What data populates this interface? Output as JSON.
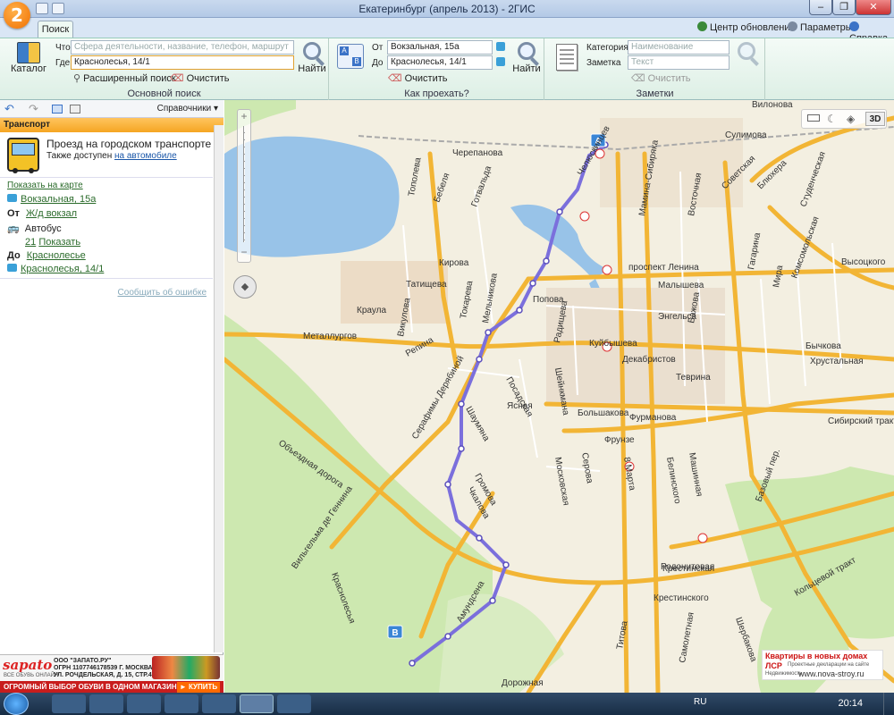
{
  "window": {
    "title": "Екатеринбург (апрель 2013) - 2ГИС"
  },
  "titlebar": {
    "logo_text": "2"
  },
  "top_links": {
    "updates": "Центр обновлений",
    "settings": "Параметры",
    "help": "Справка"
  },
  "tabs": [
    {
      "label": "Поиск"
    }
  ],
  "search": {
    "catalog_label": "Каталог",
    "what_label": "Что",
    "what_placeholder": "Сфера деятельности, название, телефон, маршрут",
    "where_label": "Где",
    "where_value": "Краснолесья, 14/1",
    "find_label": "Найти",
    "advanced_label": "Расширенный поиск",
    "clear_label": "Очистить",
    "group_label": "Основной поиск"
  },
  "route": {
    "from_label": "От",
    "from_value": "Вокзальная, 15а",
    "to_label": "До",
    "to_value": "Краснолесья, 14/1",
    "find_label": "Найти",
    "clear_label": "Очистить",
    "group_label": "Как проехать?"
  },
  "notes": {
    "category_label": "Категория",
    "category_placeholder": "Наименование",
    "note_label": "Заметка",
    "note_placeholder": "Текст",
    "clear_label": "Очистить",
    "group_label": "Заметки"
  },
  "panel": {
    "directories_label": "Справочники",
    "header": "Транспорт",
    "title": "Проезд на городском транспорте",
    "also_prefix": "Также доступен ",
    "also_link": "на автомобиле",
    "show_on_map": "Показать на карте",
    "start_addr": "Вокзальная, 15а",
    "from_label": "От",
    "from_stop": "Ж/д вокзал",
    "mode": "Автобус",
    "route_num": "21",
    "route_show": "Показать",
    "to_label": "До",
    "to_stop": "Краснолесье",
    "end_addr": "Краснолесья, 14/1",
    "report_error": "Сообщить об ошибке"
  },
  "ads": {
    "left_brand": "sapato",
    "left_tag": "ВСЕ ОБУВЬ ОНЛАЙН",
    "left_l1": "ООО \"ЗАПАТО.РУ\"",
    "left_l2": "ОГРН 1107746178539 Г. МОСКВА,",
    "left_l3": "УЛ. РОЧДЕЛЬСКАЯ, Д. 15, СТР.43",
    "left_bottom": "ОГРОМНЫЙ ВЫБОР ОБУВИ В ОДНОМ МАГАЗИНЕ!",
    "left_btn": "► КУПИТЬ",
    "right_title": "Квартиры в новых домах",
    "right_brand": "ЛСР",
    "right_sub": "Недвижимость",
    "right_small": "Проектные декларации на сайте",
    "right_url": "www.nova-stroy.ru"
  },
  "map_controls": {
    "view_3d": "3D"
  },
  "map_markers": {
    "start": "A",
    "end": "B"
  },
  "map_labels": [
    "Черепанова",
    "Бебеля",
    "Готвальда",
    "Тополева",
    "Челюскинцев",
    "Мамина-Сибиряка",
    "Восточная",
    "Советская",
    "Блюхера",
    "Студенческая",
    "Сулимова",
    "Вилонова",
    "Гагарина",
    "Комсомольская",
    "Мира",
    "Высоцкого",
    "проспект Ленина",
    "Малышева",
    "Энгельса",
    "Бажова",
    "Кирова",
    "Татищева",
    "Токарева",
    "Мельникова",
    "Попова",
    "Краула",
    "Викулова",
    "Радищева",
    "Куйбышева",
    "Бычкова",
    "Крестинская",
    "Металлургов",
    "Репина",
    "Шейнкмана",
    "Декабристов",
    "Теврина",
    "Хрустальная",
    "Посадская",
    "Ясная",
    "Шаумяна",
    "Серафимы Дерябиной",
    "Большакова",
    "Фурманова",
    "Фрунзе",
    "Белинского",
    "Машинная",
    "Сибирский тракт",
    "Объездная дорога",
    "Московская",
    "Серова",
    "8 Марта",
    "Громова",
    "Чкалова",
    "Вильгельма де Геннина",
    "Краснолесья",
    "Родонитовая",
    "Амундсена",
    "Крестинского",
    "Кольцевой тракт",
    "Шербакова",
    "Самолетная",
    "Титова",
    "Дорожная",
    "Базовый пер."
  ],
  "taskbar": {
    "lang": "RU",
    "time": "20:14"
  },
  "colors": {
    "ribbon": "#ddefe5",
    "panel_header": "#f5a623",
    "route": "#7b6fdc",
    "road_major": "#f2b535",
    "park": "#cde8b0",
    "water": "#98c3e8"
  }
}
